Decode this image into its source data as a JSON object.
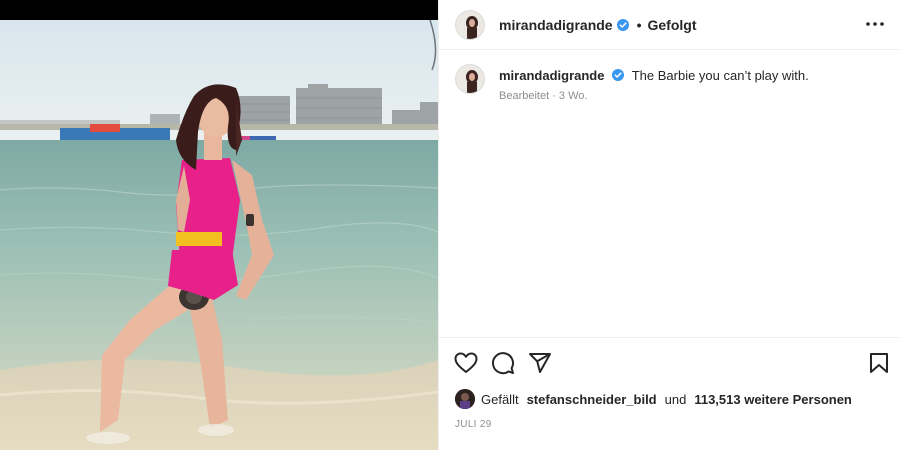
{
  "post": {
    "author": "mirandadigrande",
    "follow_state": "Gefolgt",
    "separator": "•",
    "caption": "The Barbie you can’t play with.",
    "edited": "Bearbeitet · 3 Wo.",
    "date": "JULI 29"
  },
  "likes": {
    "prefix": "Gefällt",
    "user": "stefanschneider_bild",
    "and": "und",
    "count": "113,513 weitere Personen"
  },
  "icons": {
    "verified": "verified-badge-icon",
    "more": "more-options-icon",
    "like": "heart-icon",
    "comment": "comment-icon",
    "share": "send-icon",
    "save": "bookmark-icon"
  },
  "colors": {
    "verified_blue": "#3897f0",
    "text": "#262626",
    "muted": "#8e8e8e",
    "swimsuit_pink": "#e8208a",
    "belt_yellow": "#f2c11f"
  }
}
